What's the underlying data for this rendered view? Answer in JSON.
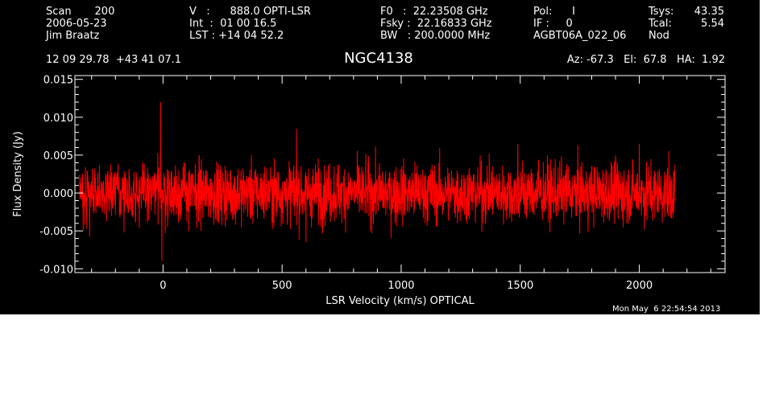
{
  "header": {
    "col1": [
      "Scan       200",
      "2006-05-23",
      "Jim Braatz"
    ],
    "col2": [
      "V   :      888.0 OPTI-LSR",
      "Int  :  01 00 16.5",
      "LST : +14 04 52.2"
    ],
    "col3": [
      "F0   :  22.23508 GHz",
      "Fsky :  22.16833 GHz",
      "BW   : 200.0000 MHz"
    ],
    "col4": [
      "Pol:      I",
      "IF :     0",
      "AGBT06A_022_06"
    ],
    "col5_labels": [
      "Tsys:",
      "Tcal:",
      "Nod"
    ],
    "col5_values": [
      "43.35",
      "5.54",
      ""
    ],
    "coords": "12 09 29.78  +43 41 07.1",
    "object": "NGC4138",
    "pointing": "Az: -67.3   El:  67.8   HA:  1.92"
  },
  "date_stamp": "Mon May  6 22:54:54 2013",
  "colors": {
    "background": "#000000",
    "foreground": "#ffffff",
    "spectrum": "#ff0000"
  },
  "chart_data": {
    "type": "line",
    "xlabel": "LSR Velocity (km/s) OPTICAL",
    "ylabel": "Flux Density (Jy)",
    "xlim": [
      -370,
      2360
    ],
    "ylim": [
      -0.0105,
      0.0155
    ],
    "x_ticks": [
      "0",
      "500",
      "1000",
      "1500",
      "2000"
    ],
    "x_tick_values": [
      0,
      500,
      1000,
      1500,
      2000
    ],
    "y_ticks": [
      "-0.010",
      "-0.005",
      "0.000",
      "0.005",
      "0.010",
      "0.015"
    ],
    "y_tick_values": [
      -0.01,
      -0.005,
      0.0,
      0.005,
      0.01,
      0.015
    ],
    "series": [
      {
        "x_range": [
          -350,
          2150
        ],
        "points": 2500,
        "noise_rms": 0.0023,
        "spike_points": [
          [
            -10,
            0.012
          ],
          [
            -5,
            -0.009
          ],
          [
            560,
            0.0085
          ],
          [
            600,
            -0.0065
          ],
          [
            1490,
            0.0065
          ],
          [
            2000,
            0.0065
          ]
        ]
      }
    ]
  }
}
